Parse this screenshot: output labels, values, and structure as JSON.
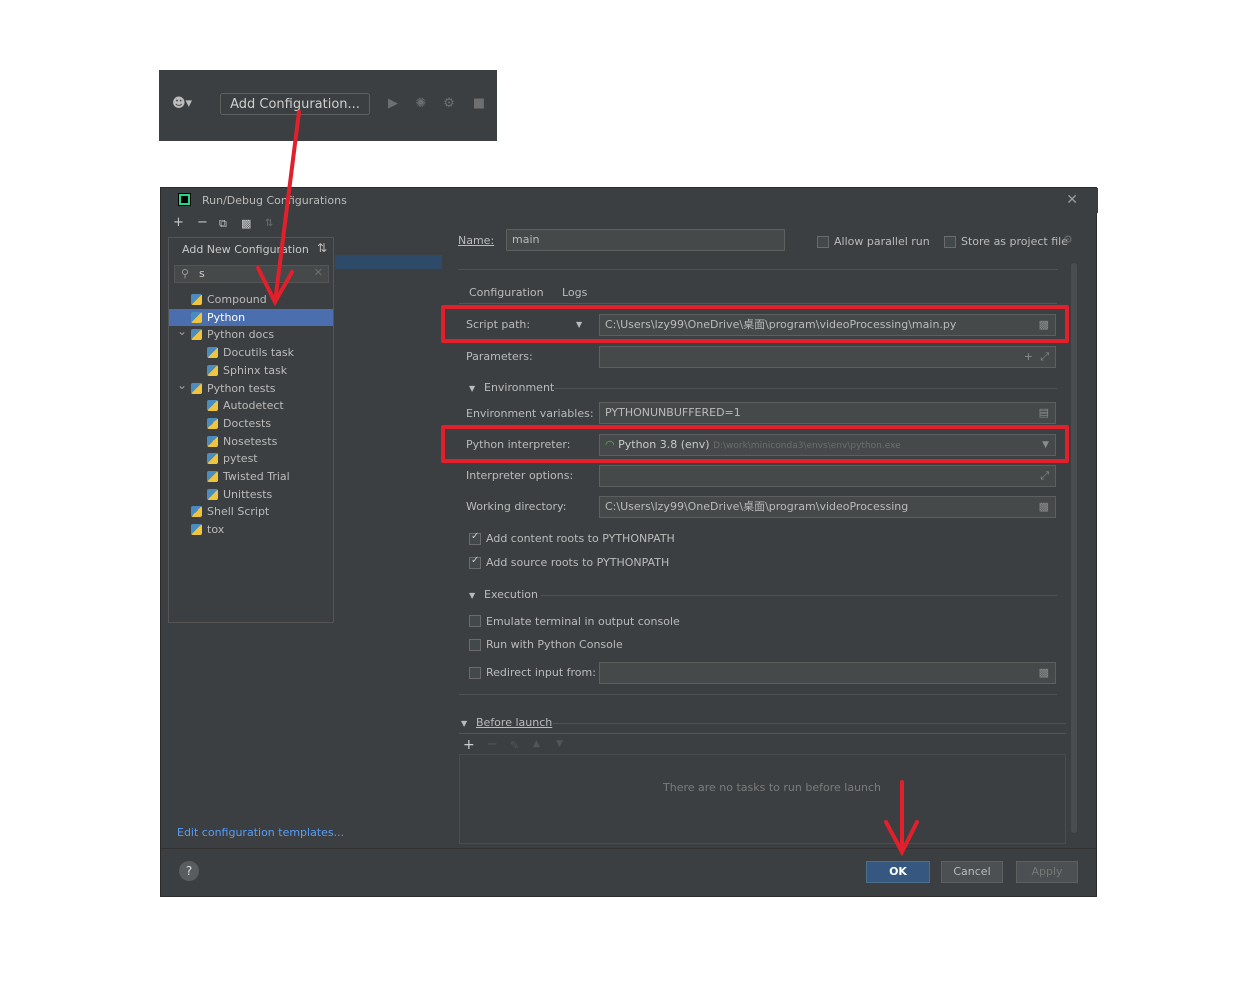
{
  "toolbar": {
    "add_config_label": "Add Configuration..."
  },
  "dialog": {
    "title": "Run/Debug Configurations",
    "toolbar_icons": [
      "add-icon",
      "remove-icon",
      "copy-icon",
      "folder-icon",
      "sort-icon"
    ]
  },
  "popup": {
    "title": "Add New Configuration",
    "search_value": "s",
    "items": [
      {
        "label": "Compound",
        "indent": 0,
        "arrow": false,
        "icon": "compound-icon"
      },
      {
        "label": "Python",
        "indent": 0,
        "arrow": false,
        "icon": "python-icon",
        "selected": true
      },
      {
        "label": "Python docs",
        "indent": 0,
        "arrow": true,
        "icon": "python-docs-icon"
      },
      {
        "label": "Docutils task",
        "indent": 1,
        "arrow": false,
        "icon": "docutils-icon"
      },
      {
        "label": "Sphinx task",
        "indent": 1,
        "arrow": false,
        "icon": "sphinx-icon"
      },
      {
        "label": "Python tests",
        "indent": 0,
        "arrow": true,
        "icon": "python-tests-icon"
      },
      {
        "label": "Autodetect",
        "indent": 1,
        "arrow": false,
        "icon": "autodetect-icon"
      },
      {
        "label": "Doctests",
        "indent": 1,
        "arrow": false,
        "icon": "doctests-icon"
      },
      {
        "label": "Nosetests",
        "indent": 1,
        "arrow": false,
        "icon": "nosetests-icon"
      },
      {
        "label": "pytest",
        "indent": 1,
        "arrow": false,
        "icon": "pytest-icon"
      },
      {
        "label": "Twisted Trial",
        "indent": 1,
        "arrow": false,
        "icon": "twisted-trial-icon"
      },
      {
        "label": "Unittests",
        "indent": 1,
        "arrow": false,
        "icon": "unittests-icon"
      },
      {
        "label": "Shell Script",
        "indent": 0,
        "arrow": false,
        "icon": "shell-script-icon"
      },
      {
        "label": "tox",
        "indent": 0,
        "arrow": false,
        "icon": "tox-icon"
      }
    ]
  },
  "edit_templates_label": "Edit configuration templates...",
  "form": {
    "name_label": "Name:",
    "name_value": "main",
    "allow_parallel_label": "Allow parallel run",
    "store_project_label": "Store as project file",
    "tabs": [
      "Configuration",
      "Logs"
    ],
    "script_path_label": "Script path:",
    "script_path_value": "C:\\Users\\lzy99\\OneDrive\\桌面\\program\\videoProcessing\\main.py",
    "parameters_label": "Parameters:",
    "environment_label": "Environment",
    "env_vars_label": "Environment variables:",
    "env_vars_value": "PYTHONUNBUFFERED=1",
    "interpreter_label": "Python interpreter:",
    "interpreter_name": "Python 3.8 (env)",
    "interpreter_path": "D:\\work\\miniconda3\\envs\\env\\python.exe",
    "interp_options_label": "Interpreter options:",
    "working_dir_label": "Working directory:",
    "working_dir_value": "C:\\Users\\lzy99\\OneDrive\\桌面\\program\\videoProcessing",
    "content_roots_label": "Add content roots to PYTHONPATH",
    "source_roots_label": "Add source roots to PYTHONPATH",
    "execution_label": "Execution",
    "emulate_terminal_label": "Emulate terminal in output console",
    "python_console_label": "Run with Python Console",
    "redirect_input_label": "Redirect input from:",
    "before_launch_label": "Before launch",
    "no_tasks_text": "There are no tasks to run before launch"
  },
  "buttons": {
    "ok": "OK",
    "cancel": "Cancel",
    "apply": "Apply"
  },
  "colors": {
    "dialog_bg": "#3c3f41",
    "selection": "#4b6eaf",
    "link": "#589df6",
    "annotation_red": "#e1202b",
    "ok_button": "#365880"
  }
}
